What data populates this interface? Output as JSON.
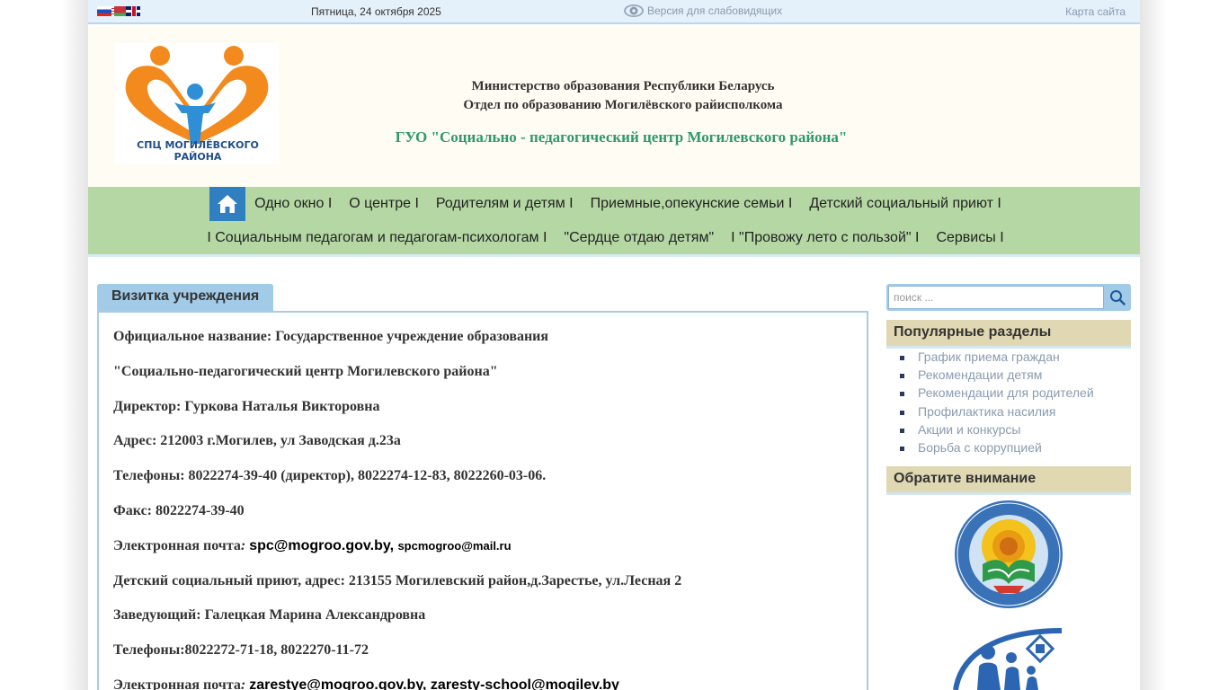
{
  "topbar": {
    "date": "Пятница, 24 октября 2025",
    "vision_link": "Версия для слабовидящих",
    "sitemap_link": "Карта сайта",
    "flags": [
      "ru-flag",
      "by-flag",
      "en-flag"
    ]
  },
  "header": {
    "logo_caption": "СПЦ МОГИЛЁВСКОГО РАЙОНА",
    "ministry_line1": "Министерство образования Республики Беларусь",
    "ministry_line2": "Отдел по образованию  Могилёвского райисполкома",
    "org_title": "ГУО  \"Социально - педагогический центр Могилевского района\""
  },
  "nav": {
    "row1": [
      "Одно окно I",
      "О центре I",
      "Родителям и детям I",
      "Приемные,опекунские семьи I",
      "Детский социальный приют I"
    ],
    "row2": [
      "I Социальным педагогам и педагогам-психологам I",
      "\"Сердце отдаю детям\"",
      "I \"Провожу лето с пользой\" I",
      "Сервисы I"
    ]
  },
  "main": {
    "tab_title": "Визитка учреждения",
    "line1": "Официальное название: Государственное учреждение образования",
    "line2": "\"Социально-педагогический центр Могилевского района\"",
    "line3": "Директор: Гуркова Наталья Викторовна",
    "line4": "Адрес: 212003 г.Могилев, ул Заводская д.23а",
    "line5": "Телефоны: 8022274-39-40 (директор), 8022274-12-83, 8022260-03-06.",
    "line6": "Факс: 8022274-39-40",
    "line7_label": "Электронная почта",
    "line7_colon": ": ",
    "line7_email1": "spc@mogroo.gov.by",
    "line7_sep": ",  ",
    "line7_email2": "spcmogroo@mail.ru",
    "line8": "Детский социальный приют, адрес:  213155 Могилевский район,д.Зарестье, ул.Лесная 2",
    "line9": "Заведующий: Галецкая Марина Александровна",
    "line10": "Телефоны:8022272-71-18, 8022270-11-72",
    "line11_label": "Электронная почта",
    "line11_colon": ": ",
    "line11_email1": "zarestye@mogroo.gov.by",
    "line11_sep": ", ",
    "line11_email2": "zaresty-school@mogilev.by"
  },
  "sidebar": {
    "search_placeholder": "поиск ...",
    "popular_title": "Популярные разделы",
    "popular_items": [
      "График приема граждан",
      "Рекомендации детям",
      "Рекомендации для родителей",
      "Профилактика насилия",
      "Акции и конкурсы",
      "Борьба с коррупцией"
    ],
    "attention_title": "Обратите внимание"
  },
  "colors": {
    "topbar_bg": "#e4f0fa",
    "header_bg": "#fffcf3",
    "nav_bg": "#b5d7a4",
    "home_blue": "#2f7fc1",
    "org_green": "#2e9a6a",
    "side_header": "#dfd8b2",
    "tab_blue": "#a2cbe8",
    "link_gray": "#8a9bb0"
  }
}
